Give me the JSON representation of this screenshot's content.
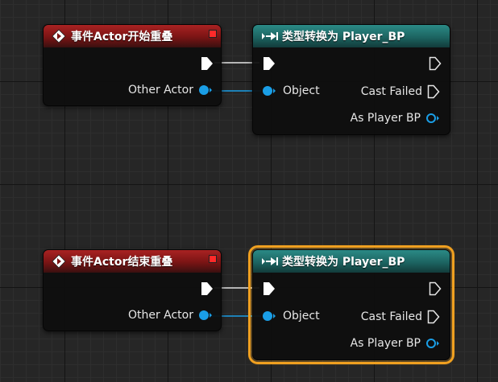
{
  "graph": {
    "grid_color": "#262626",
    "wire_exec_color": "#e6e6e6",
    "wire_object_color": "#1a9ee6",
    "nodes": [
      {
        "id": "begin-overlap",
        "kind": "event",
        "title": "事件Actor开始重叠",
        "header_color": "#a82222",
        "icon": "event-diamond-icon",
        "pins": {
          "output_object": "Other Actor"
        }
      },
      {
        "id": "cast-1",
        "kind": "cast",
        "title": "类型转换为 Player_BP",
        "header_color": "#2b8a86",
        "icon": "cast-arrow-icon",
        "pins": {
          "input_object": "Object",
          "cast_failed": "Cast Failed",
          "as_output": "As Player BP"
        }
      },
      {
        "id": "end-overlap",
        "kind": "event",
        "title": "事件Actor结束重叠",
        "header_color": "#a82222",
        "icon": "event-diamond-icon",
        "pins": {
          "output_object": "Other Actor"
        }
      },
      {
        "id": "cast-2",
        "kind": "cast",
        "title": "类型转换为 Player_BP",
        "header_color": "#2b8a86",
        "icon": "cast-arrow-icon",
        "selected": true,
        "selection_color": "#f0a020",
        "pins": {
          "input_object": "Object",
          "cast_failed": "Cast Failed",
          "as_output": "As Player BP"
        }
      }
    ]
  }
}
